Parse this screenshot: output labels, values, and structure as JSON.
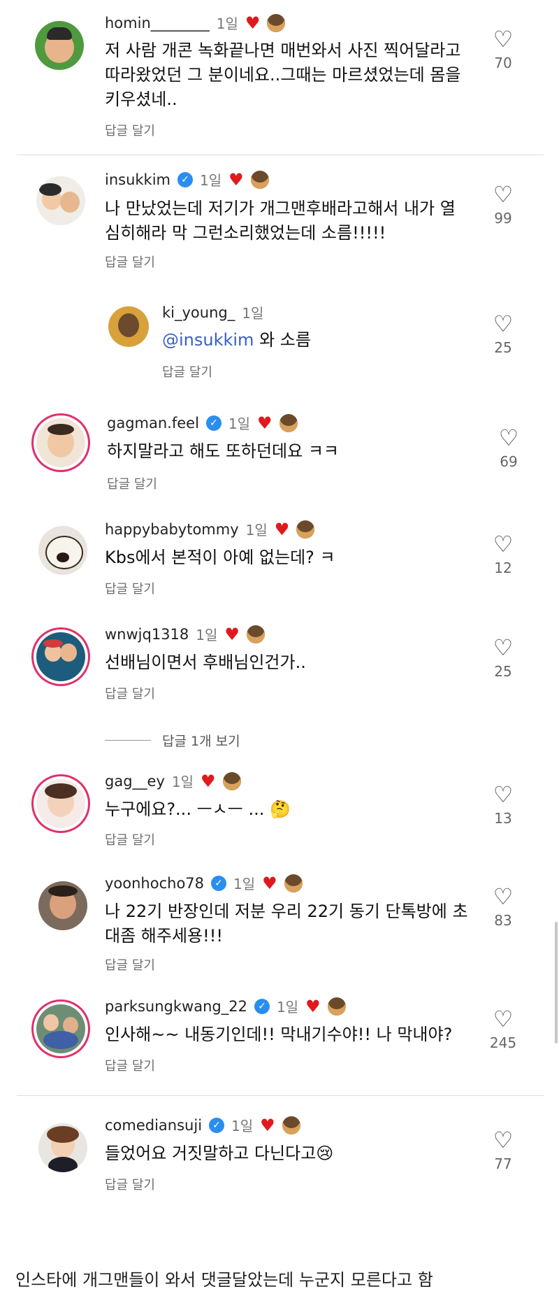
{
  "reply_label": "답글 달기",
  "comments": [
    {
      "username": "homin________",
      "time": "1일",
      "text_lines": [
        "저 사람 개콘 녹화끝나면 매번와서 사진 찍어달라고",
        "따라왔었던 그 분이네요..그때는 마르셨었는데 몸을",
        "키우셨네.."
      ],
      "likes": "70",
      "verified": false
    },
    {
      "username": "insukkim",
      "time": "1일",
      "text_lines": [
        "나 만났었는데 저기가 개그맨후배라고해서 내가 열",
        "심히해라 막 그런소리했었는데 소름!!!!!"
      ],
      "likes": "99",
      "verified": true
    },
    {
      "username": "ki_young_",
      "time": "1일",
      "mention": "@insukkim",
      "text_after_mention": " 와 소름",
      "likes": "25",
      "verified": false
    },
    {
      "username": "gagman.feel",
      "time": "1일",
      "text_lines": [
        "하지말라고 해도 또하던데요 ㅋㅋ"
      ],
      "likes": "69",
      "verified": true
    },
    {
      "username": "happybabytommy",
      "time": "1일",
      "text_lines": [
        "Kbs에서 본적이 아예 없는데? ㅋ"
      ],
      "likes": "12",
      "verified": false
    },
    {
      "username": "wnwjq1318",
      "time": "1일",
      "text_lines": [
        "선배님이면서 후배님인건가.."
      ],
      "likes": "25",
      "verified": false
    },
    {
      "username": "gag__ey",
      "time": "1일",
      "text_lines": [
        "누구에요?... ㅡㅅㅡ ... 🤔"
      ],
      "likes": "13",
      "verified": false
    },
    {
      "username": "yoonhocho78",
      "time": "1일",
      "text_lines": [
        "나 22기 반장인데 저분 우리 22기 동기 단톡방에 초",
        "대좀 해주세용!!!"
      ],
      "likes": "83",
      "verified": true
    },
    {
      "username": "parksungkwang_22",
      "time": "1일",
      "text_lines": [
        "인사해~~ 내동기인데!! 막내기수야!! 나 막내야?"
      ],
      "likes": "245",
      "verified": true
    },
    {
      "username": "comediansuji",
      "time": "1일",
      "text_lines": [
        "들었어요 거짓말하고 다닌다고😢"
      ],
      "likes": "77",
      "verified": true
    }
  ],
  "view_replies": "답글 1개 보기",
  "caption": "인스타에 개그맨들이 와서 댓글달았는데 누군지 모른다고 함",
  "icons": {
    "like": "heart-outline-icon",
    "creator_like": "filled-heart-icon",
    "verified": "verified-badge-icon"
  },
  "colors": {
    "heart": "#e0191e",
    "verified": "#2a8ef0",
    "mention": "#375fc6",
    "story_ring": "#e1306c"
  }
}
